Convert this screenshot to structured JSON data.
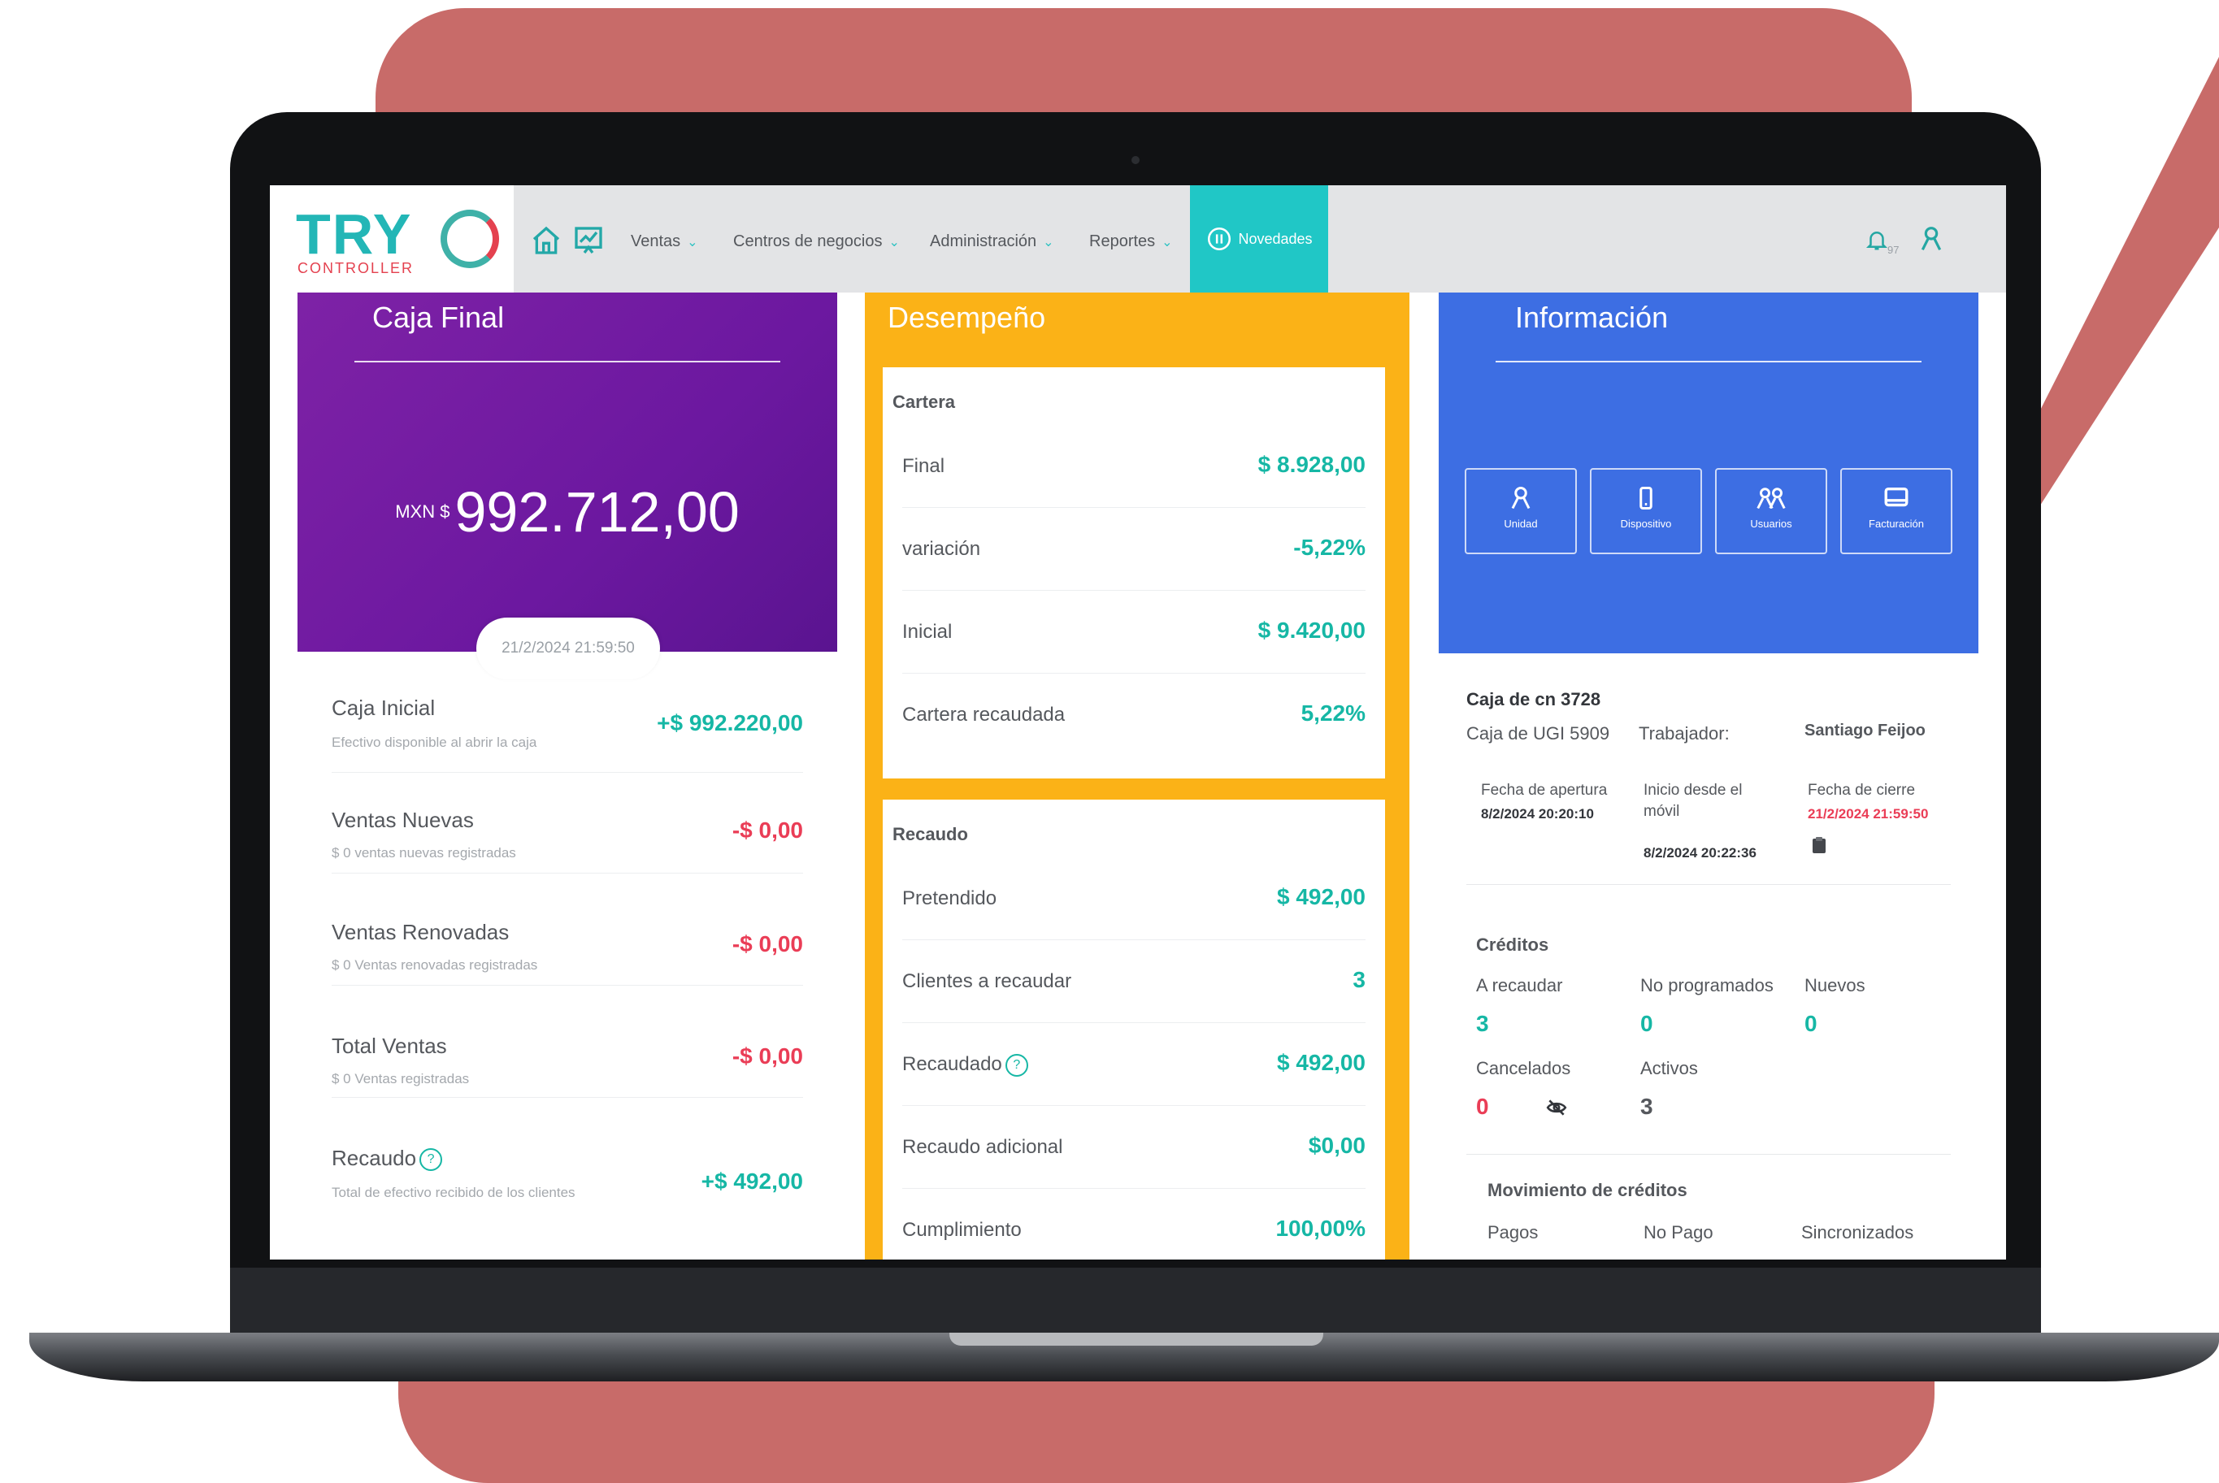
{
  "nav": {
    "logo_text": "TRY",
    "logo_sub": "CONTROLLER",
    "items": [
      "Ventas",
      "Centros de negocios",
      "Administración",
      "Reportes"
    ],
    "novedades": "Novedades",
    "notif_count": "97"
  },
  "caja": {
    "title": "Caja Final",
    "currency": "MXN $",
    "amount": "992.712,00",
    "date": "21/2/2024 21:59:50",
    "rows": [
      {
        "title": "Caja Inicial",
        "sub": "Efectivo disponible al abrir la caja",
        "value": "+$ 992.220,00"
      },
      {
        "title": "Ventas Nuevas",
        "sub": "$ 0 ventas nuevas registradas",
        "value": "-$ 0,00"
      },
      {
        "title": "Ventas Renovadas",
        "sub": "$ 0 Ventas renovadas registradas",
        "value": "-$ 0,00"
      },
      {
        "title": "Total Ventas",
        "sub": "$ 0 Ventas registradas",
        "value": "-$ 0,00"
      },
      {
        "title": "Recaudo",
        "sub": "Total de efectivo recibido de los clientes",
        "value": "+$ 492,00"
      }
    ]
  },
  "desempeno": {
    "title": "Desempeño",
    "cartera": {
      "section": "Cartera",
      "rows": [
        {
          "label": "Final",
          "value": "$ 8.928,00"
        },
        {
          "label": "variación",
          "value": "-5,22%"
        },
        {
          "label": "Inicial",
          "value": "$ 9.420,00"
        },
        {
          "label": "Cartera recaudada",
          "value": "5,22%"
        }
      ]
    },
    "recaudo": {
      "section": "Recaudo",
      "rows": [
        {
          "label": "Pretendido",
          "value": "$ 492,00"
        },
        {
          "label": "Clientes a recaudar",
          "value": "3"
        },
        {
          "label": "Recaudado",
          "value": "$ 492,00"
        },
        {
          "label": "Recaudo adicional",
          "value": "$0,00"
        },
        {
          "label": "Cumplimiento",
          "value": "100,00%"
        }
      ]
    }
  },
  "info": {
    "title": "Información",
    "tiles": [
      "Unidad",
      "Dispositivo",
      "Usuarios",
      "Facturación"
    ],
    "caja_name": "Caja de cn 3728",
    "caja_sub": "Caja de UGI 5909",
    "trabajador_label": "Trabajador:",
    "trabajador": "Santiago Feijoo",
    "apertura_label": "Fecha de apertura",
    "apertura": "8/2/2024 20:20:10",
    "inicio_label": "Inicio desde el móvil",
    "inicio": "8/2/2024 20:22:36",
    "cierre_label": "Fecha de cierre",
    "cierre": "21/2/2024 21:59:50",
    "creditos_title": "Créditos",
    "creditos": {
      "a_recaudar_label": "A recaudar",
      "a_recaudar": "3",
      "no_prog_label": "No programados",
      "no_prog": "0",
      "nuevos_label": "Nuevos",
      "nuevos": "0",
      "cancelados_label": "Cancelados",
      "cancelados": "0",
      "activos_label": "Activos",
      "activos": "3"
    },
    "mov_title": "Movimiento de créditos",
    "mov_cols": [
      "Pagos",
      "No Pago",
      "Sincronizados"
    ]
  },
  "colors": {
    "bg_accent": "#c86b69",
    "teal": "#20c7c6",
    "purple": "#7e22a6",
    "amber": "#fbb217",
    "blue": "#3d6ee3"
  }
}
